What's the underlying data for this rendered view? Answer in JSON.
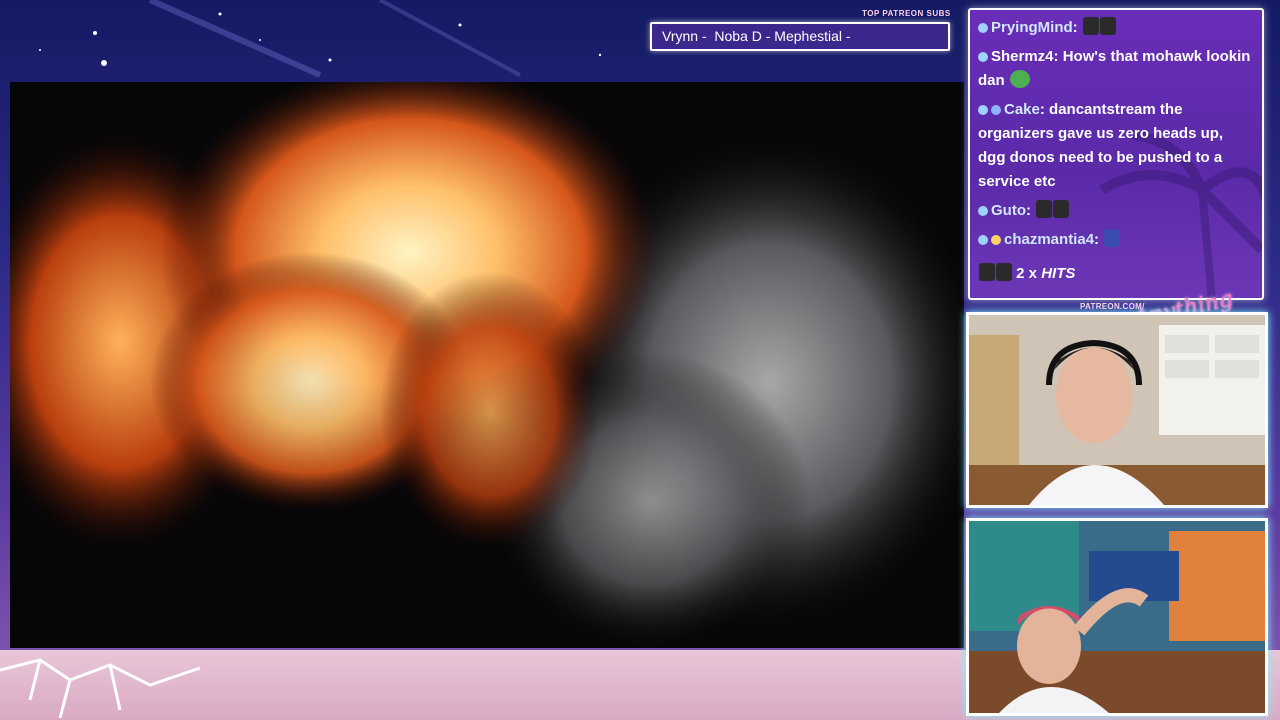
{
  "overlay": {
    "top_subs_label": "TOP PATREON SUBS",
    "top_subs_names": "Vrynn -  Noba D - Mephestial -",
    "patreon_url": "PATREON.COM/",
    "brand_text": "Anything Else?"
  },
  "chat": {
    "messages": [
      {
        "user": "PryingMind",
        "sep": ":",
        "text": ""
      },
      {
        "user": "Shermz4",
        "sep": ":",
        "text": "How's that mohawk lookin dan"
      },
      {
        "user": "Cake",
        "sep": ":",
        "text": "dancantstream the organizers gave us zero heads up, dgg donos need to be pushed to a service etc"
      },
      {
        "user": "Guto",
        "sep": ":",
        "text": ""
      },
      {
        "user": "chazmantia4",
        "sep": ":",
        "text": ""
      }
    ],
    "hits": {
      "count": "2 x",
      "label": "HITS"
    }
  },
  "colors": {
    "accent": "#ff6fc8",
    "chat_bg": "#6a2db8",
    "cam_glow": "#7ef3ff"
  }
}
